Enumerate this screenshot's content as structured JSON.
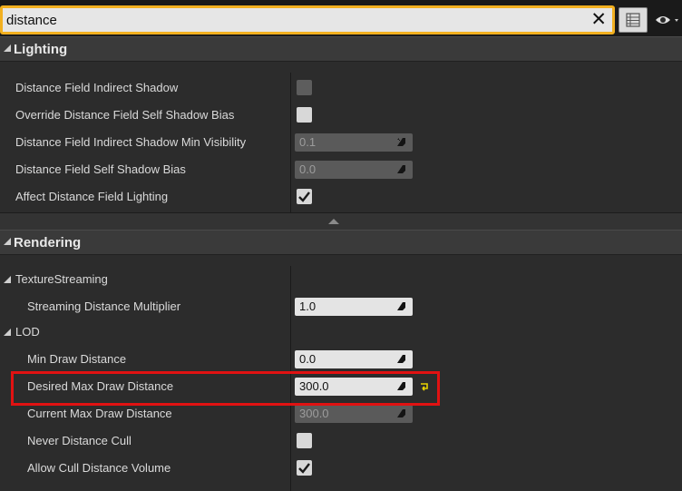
{
  "search": {
    "value": "distance"
  },
  "sections": {
    "lighting": {
      "title": "Lighting",
      "rows": [
        {
          "label": "Distance Field Indirect Shadow",
          "type": "checkbox",
          "checked": false,
          "enabled": false
        },
        {
          "label": "Override Distance Field Self Shadow Bias",
          "type": "checkbox",
          "checked": false,
          "enabled": true
        },
        {
          "label": "Distance Field Indirect Shadow Min Visibility",
          "type": "number",
          "value": "0.1",
          "enabled": false
        },
        {
          "label": "Distance Field Self Shadow Bias",
          "type": "number",
          "value": "0.0",
          "enabled": false
        },
        {
          "label": "Affect Distance Field Lighting",
          "type": "checkbox",
          "checked": true,
          "enabled": true
        }
      ]
    },
    "rendering": {
      "title": "Rendering",
      "groups": {
        "texture_streaming": {
          "title": "TextureStreaming",
          "rows": [
            {
              "label": "Streaming Distance Multiplier",
              "type": "number",
              "value": "1.0",
              "enabled": true
            }
          ]
        },
        "lod": {
          "title": "LOD",
          "rows": [
            {
              "label": "Min Draw Distance",
              "type": "number",
              "value": "0.0",
              "enabled": true
            },
            {
              "label": "Desired Max Draw Distance",
              "type": "number",
              "value": "300.0",
              "enabled": true,
              "modified": true
            },
            {
              "label": "Current Max Draw Distance",
              "type": "number",
              "value": "300.0",
              "enabled": false
            },
            {
              "label": "Never Distance Cull",
              "type": "checkbox",
              "checked": false,
              "enabled": true
            },
            {
              "label": "Allow Cull Distance Volume",
              "type": "checkbox",
              "checked": true,
              "enabled": true
            }
          ]
        }
      }
    }
  },
  "colors": {
    "search_focus": "#f2b020",
    "highlight_box": "#e11212",
    "reset_arrow": "#e8d200"
  }
}
